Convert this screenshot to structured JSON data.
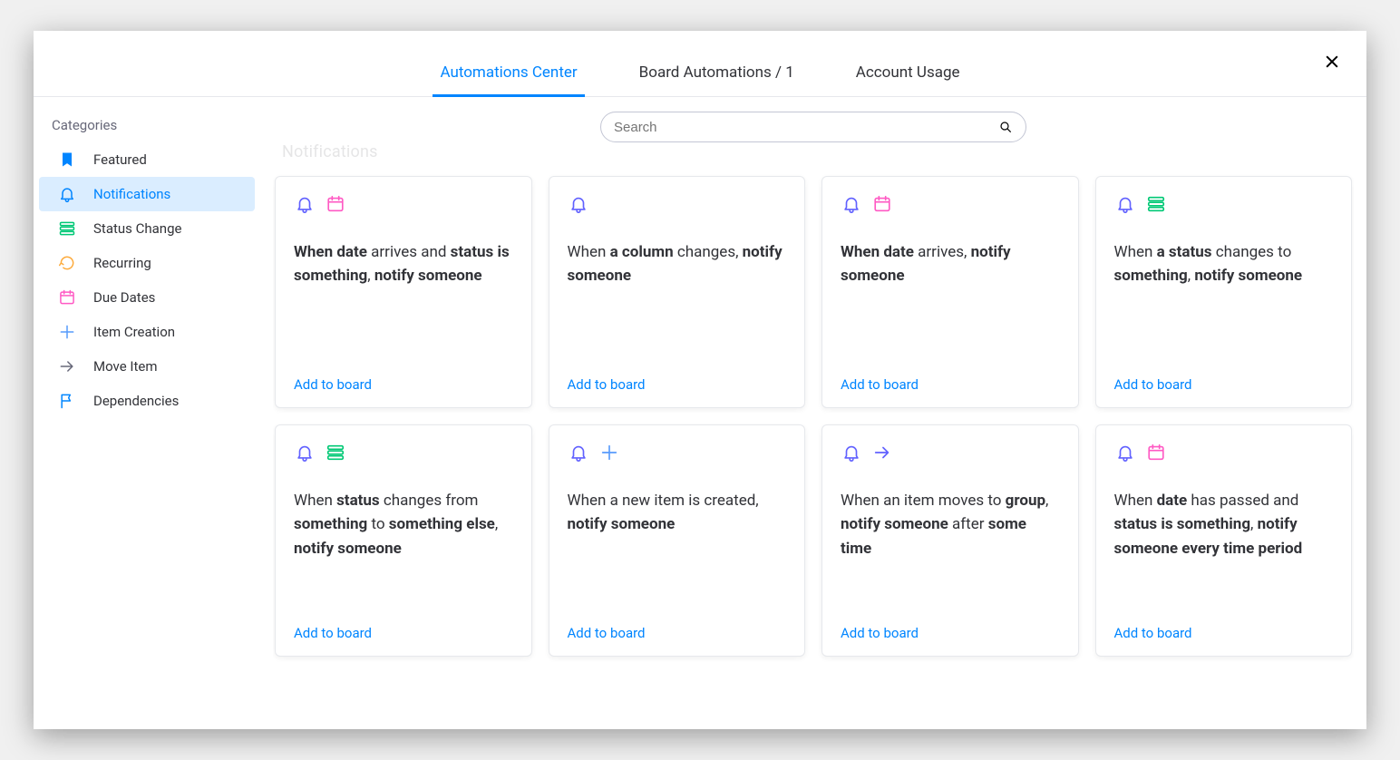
{
  "close_label": "Close",
  "tabs": [
    {
      "label": "Automations Center",
      "active": true
    },
    {
      "label": "Board Automations / 1",
      "active": false
    },
    {
      "label": "Account Usage",
      "active": false
    }
  ],
  "sidebar": {
    "title": "Categories",
    "items": [
      {
        "label": "Featured",
        "icon": "bookmark",
        "color": "c-blue",
        "active": false
      },
      {
        "label": "Notifications",
        "icon": "bell",
        "color": "c-blue",
        "active": true
      },
      {
        "label": "Status Change",
        "icon": "status",
        "color": "c-green",
        "active": false
      },
      {
        "label": "Recurring",
        "icon": "recurring",
        "color": "c-orange",
        "active": false
      },
      {
        "label": "Due Dates",
        "icon": "calendar",
        "color": "c-pink",
        "active": false
      },
      {
        "label": "Item Creation",
        "icon": "plus",
        "color": "c-light",
        "active": false
      },
      {
        "label": "Move Item",
        "icon": "arrow",
        "color": "c-gray",
        "active": false
      },
      {
        "label": "Dependencies",
        "icon": "flag",
        "color": "c-blue",
        "active": false
      }
    ]
  },
  "search": {
    "placeholder": "Search"
  },
  "section_header": "Notifications",
  "add_to_board_label": "Add to board",
  "cards": [
    {
      "icons": [
        {
          "icon": "bell",
          "color": "c-purple"
        },
        {
          "icon": "calendar",
          "color": "c-pink"
        }
      ],
      "segments": [
        {
          "t": "When ",
          "b": true
        },
        {
          "t": "date ",
          "b": true
        },
        {
          "t": "arrives and ",
          "b": false
        },
        {
          "t": "status ",
          "b": true
        },
        {
          "t": "is ",
          "b": true
        },
        {
          "t": "something",
          "b": true
        },
        {
          "t": ", ",
          "b": false
        },
        {
          "t": "notify someone",
          "b": true
        }
      ]
    },
    {
      "icons": [
        {
          "icon": "bell",
          "color": "c-purple"
        }
      ],
      "segments": [
        {
          "t": "When ",
          "b": false
        },
        {
          "t": "a column ",
          "b": true
        },
        {
          "t": "changes, ",
          "b": false
        },
        {
          "t": "notify someone",
          "b": true
        }
      ]
    },
    {
      "icons": [
        {
          "icon": "bell",
          "color": "c-purple"
        },
        {
          "icon": "calendar",
          "color": "c-pink"
        }
      ],
      "segments": [
        {
          "t": "When ",
          "b": true
        },
        {
          "t": "date ",
          "b": true
        },
        {
          "t": "arrives, ",
          "b": false
        },
        {
          "t": "notify someone",
          "b": true
        }
      ]
    },
    {
      "icons": [
        {
          "icon": "bell",
          "color": "c-purple"
        },
        {
          "icon": "status",
          "color": "c-green"
        }
      ],
      "segments": [
        {
          "t": "When ",
          "b": false
        },
        {
          "t": "a status ",
          "b": true
        },
        {
          "t": "changes to ",
          "b": false
        },
        {
          "t": "something",
          "b": true
        },
        {
          "t": ", ",
          "b": false
        },
        {
          "t": "notify someone",
          "b": true
        }
      ]
    },
    {
      "icons": [
        {
          "icon": "bell",
          "color": "c-purple"
        },
        {
          "icon": "status",
          "color": "c-green"
        }
      ],
      "segments": [
        {
          "t": "When ",
          "b": false
        },
        {
          "t": "status ",
          "b": true
        },
        {
          "t": "changes from ",
          "b": false
        },
        {
          "t": "something ",
          "b": true
        },
        {
          "t": "to ",
          "b": false
        },
        {
          "t": "something else",
          "b": true
        },
        {
          "t": ", ",
          "b": false
        },
        {
          "t": "notify someone",
          "b": true
        }
      ]
    },
    {
      "icons": [
        {
          "icon": "bell",
          "color": "c-purple"
        },
        {
          "icon": "plus",
          "color": "c-light"
        }
      ],
      "segments": [
        {
          "t": "When a new item is created, ",
          "b": false
        },
        {
          "t": "notify someone",
          "b": true
        }
      ]
    },
    {
      "icons": [
        {
          "icon": "bell",
          "color": "c-purple"
        },
        {
          "icon": "arrow",
          "color": "c-purple"
        }
      ],
      "segments": [
        {
          "t": "When an item moves to ",
          "b": false
        },
        {
          "t": "group",
          "b": true
        },
        {
          "t": ", ",
          "b": false
        },
        {
          "t": "notify someone ",
          "b": true
        },
        {
          "t": "after ",
          "b": false
        },
        {
          "t": "some time",
          "b": true
        }
      ]
    },
    {
      "icons": [
        {
          "icon": "bell",
          "color": "c-purple"
        },
        {
          "icon": "calendar",
          "color": "c-pink"
        }
      ],
      "segments": [
        {
          "t": "When ",
          "b": false
        },
        {
          "t": "date ",
          "b": true
        },
        {
          "t": "has passed and ",
          "b": false
        },
        {
          "t": "status ",
          "b": true
        },
        {
          "t": "is ",
          "b": true
        },
        {
          "t": "something",
          "b": true
        },
        {
          "t": ", ",
          "b": false
        },
        {
          "t": "notify someone ",
          "b": true
        },
        {
          "t": "every time period",
          "b": true
        }
      ]
    }
  ]
}
